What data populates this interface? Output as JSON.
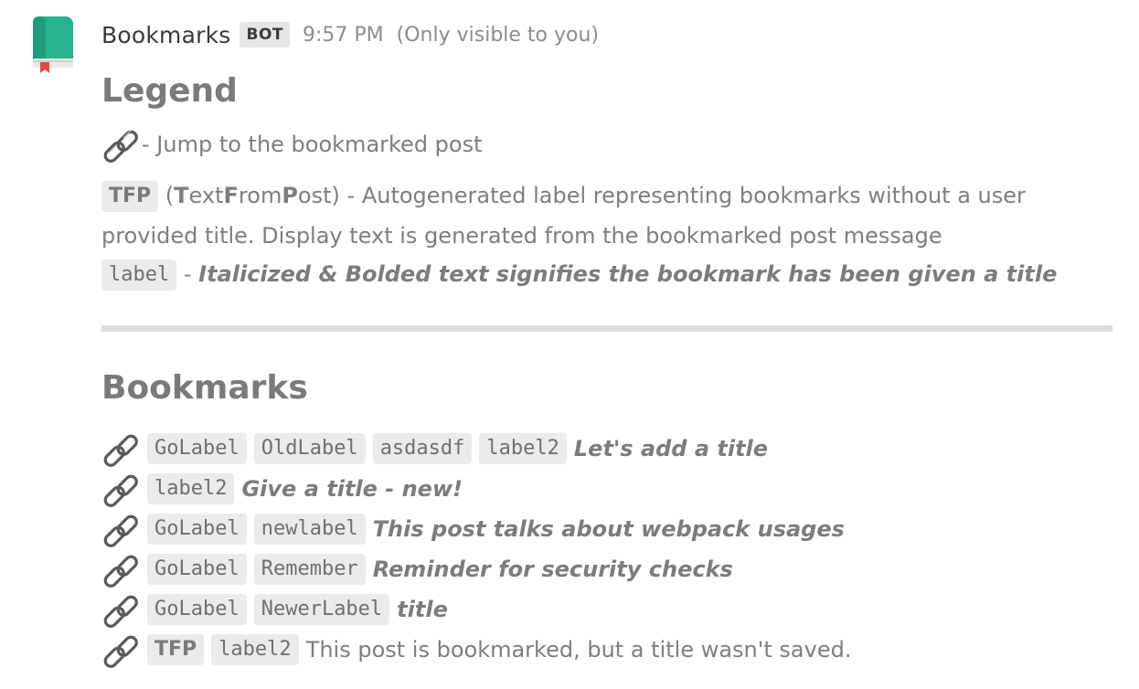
{
  "message": {
    "username": "Bookmarks",
    "badge": "BOT",
    "time": "9:57 PM",
    "visibility": "(Only visible to you)"
  },
  "legend": {
    "heading": "Legend",
    "link_desc": " - Jump to the bookmarked post",
    "tfp_chip": "TFP",
    "tfp_open": " (",
    "tfp_T": "T",
    "tfp_ext": "ext",
    "tfp_F": "F",
    "tfp_rom": "rom",
    "tfp_P": "P",
    "tfp_ost": "ost",
    "tfp_desc": ") - Autogenerated label representing bookmarks without a user provided title.  Display text is generated from the bookmarked post message",
    "label_chip": "label",
    "label_sep": " - ",
    "label_desc": "Italicized & Bolded text signifies the bookmark has been given a title"
  },
  "bookmarks": {
    "heading": "Bookmarks",
    "rows": [
      {
        "labels": [
          "GoLabel",
          "OldLabel",
          "asdasdf",
          "label2"
        ],
        "title": "Let's add a title"
      },
      {
        "labels": [
          "label2"
        ],
        "title": "Give a title - new!"
      },
      {
        "labels": [
          "GoLabel",
          "newlabel"
        ],
        "title": "This post talks about webpack usages"
      },
      {
        "labels": [
          "GoLabel",
          "Remember"
        ],
        "title": "Reminder for security checks"
      },
      {
        "labels": [
          "GoLabel",
          "NewerLabel"
        ],
        "title": "title"
      },
      {
        "tfp": "TFP",
        "labels": [
          "label2"
        ],
        "text": "This post is bookmarked, but a title wasn't saved."
      }
    ]
  },
  "colors": {
    "avatar_green": "#26b38e",
    "avatar_dark": "#1d8f72",
    "bookmark_red": "#e7473c",
    "divider": "#dcdcdc"
  },
  "icons": {
    "avatar": "book-avatar",
    "link": "link-chain-icon"
  }
}
